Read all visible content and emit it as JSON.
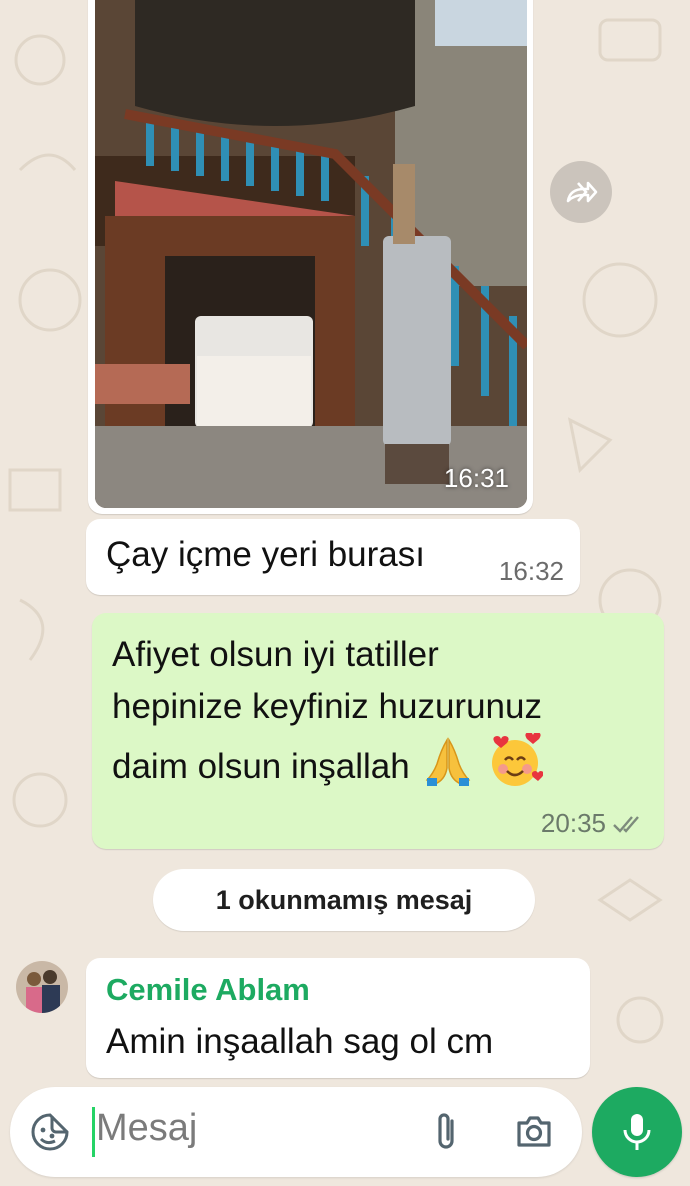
{
  "image_message": {
    "time": "16:31",
    "forward_icon": "share-forward-icon"
  },
  "messages": [
    {
      "direction": "in",
      "text": "Çay içme yeri burası",
      "time": "16:32"
    },
    {
      "direction": "out",
      "lines": [
        "Afiyet olsun iyi tatiller",
        "hepinize keyfiniz huzurunuz",
        "daim olsun inşallah"
      ],
      "emojis": [
        "folded-hands-emoji",
        "smiling-face-with-hearts-emoji"
      ],
      "time": "20:35",
      "status_icon": "double-check-icon"
    }
  ],
  "unread_divider": "1 okunmamış mesaj",
  "group_message": {
    "sender": "Cemile Ablam",
    "text": "Amin   inşaallah sag ol cm",
    "avatar_icon": "sender-avatar"
  },
  "composer": {
    "placeholder": "Mesaj",
    "icons": [
      "sticker-icon",
      "attachment-icon",
      "camera-icon",
      "microphone-icon"
    ]
  },
  "colors": {
    "background": "#efe7dd",
    "outgoing_bubble": "#dcf8c6",
    "accent": "#1daa61",
    "sender_name": "#1daa61"
  }
}
